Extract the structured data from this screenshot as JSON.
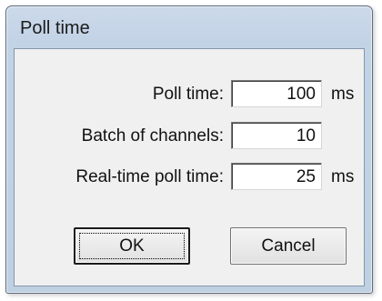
{
  "window": {
    "title": "Poll time"
  },
  "form": {
    "poll_time": {
      "label": "Poll time:",
      "value": "100",
      "unit": "ms"
    },
    "batch": {
      "label": "Batch of channels:",
      "value": "10"
    },
    "realtime_poll_time": {
      "label": "Real-time poll time:",
      "value": "25",
      "unit": "ms"
    }
  },
  "buttons": {
    "ok_label": "OK",
    "cancel_label": "Cancel"
  }
}
